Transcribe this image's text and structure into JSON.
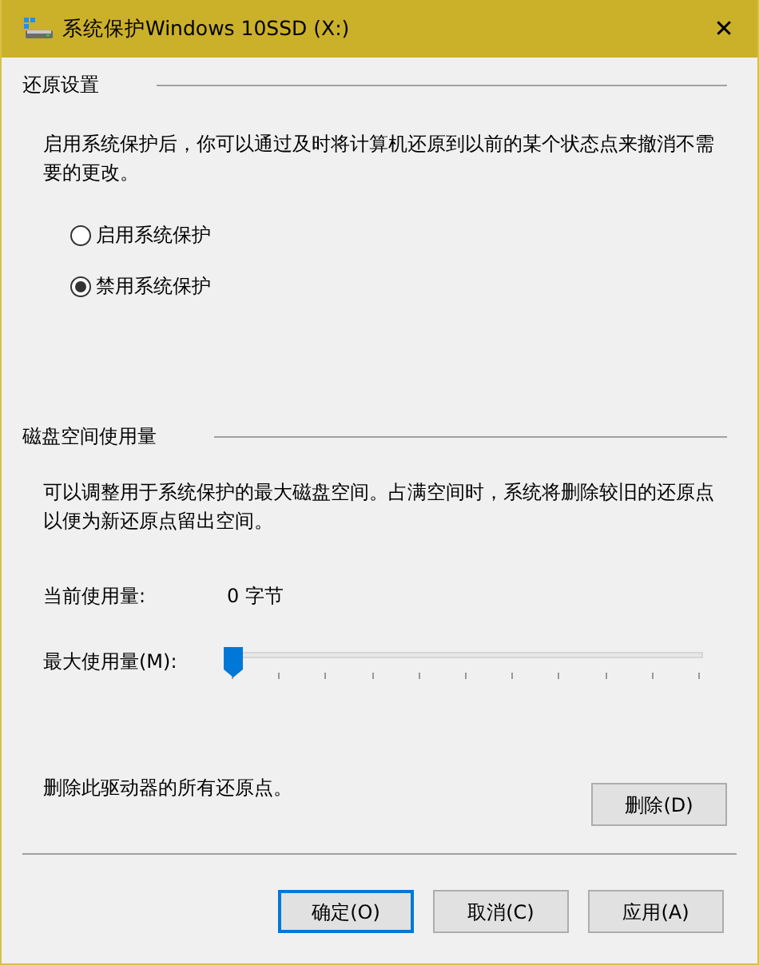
{
  "window": {
    "title": "系统保护Windows 10SSD (X:)",
    "close": "✕"
  },
  "restore_settings": {
    "heading": "还原设置",
    "description": "启用系统保护后，你可以通过及时将计算机还原到以前的某个状态点来撤消不需要的更改。",
    "options": [
      {
        "label": "启用系统保护",
        "selected": false
      },
      {
        "label": "禁用系统保护",
        "selected": true
      }
    ]
  },
  "disk_usage": {
    "heading": "磁盘空间使用量",
    "description": "可以调整用于系统保护的最大磁盘空间。占满空间时，系统将删除较旧的还原点以便为新还原点留出空间。",
    "current_label": "当前使用量:",
    "current_value": "0 字节",
    "max_label": "最大使用量(M):",
    "max_slider": {
      "level": 0
    },
    "delete_text": "删除此驱动器的所有还原点。",
    "delete_button": "删除(D)"
  },
  "buttons": [
    {
      "label": "确定(O)",
      "default": true
    },
    {
      "label": "取消(C)",
      "default": false
    },
    {
      "label": "应用(A)",
      "default": false
    }
  ]
}
